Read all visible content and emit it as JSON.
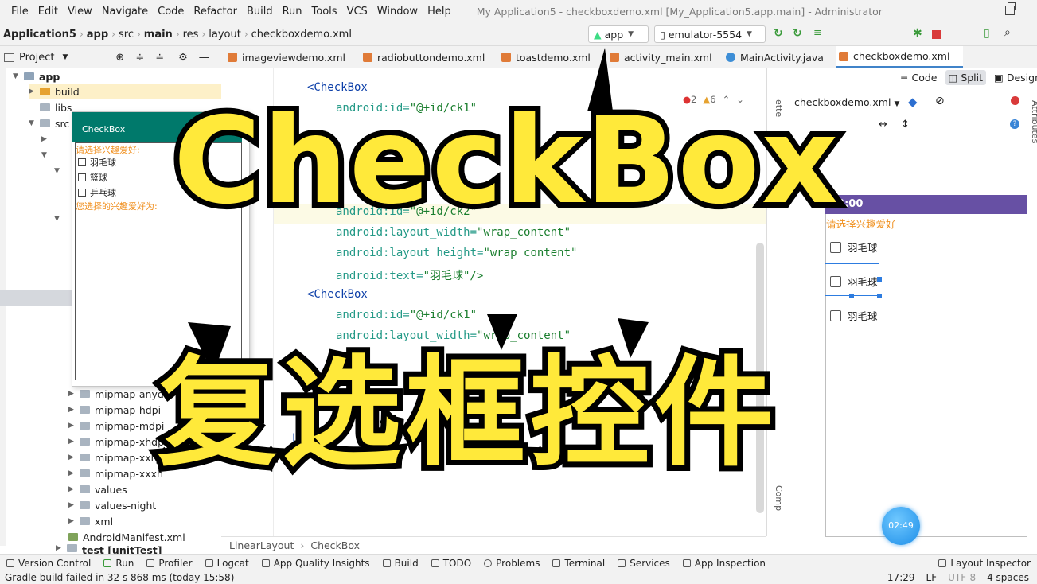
{
  "window": {
    "title": "My Application5 - checkboxdemo.xml [My_Application5.app.main] - Administrator"
  },
  "menu": [
    "File",
    "Edit",
    "View",
    "Navigate",
    "Code",
    "Refactor",
    "Build",
    "Run",
    "Tools",
    "VCS",
    "Window",
    "Help"
  ],
  "breadcrumb": [
    "Application5",
    "app",
    "src",
    "main",
    "res",
    "layout",
    "checkboxdemo.xml"
  ],
  "run_config": {
    "module": "app",
    "device": "emulator-5554"
  },
  "tabs": [
    "imageviewdemo.xml",
    "radiobuttondemo.xml",
    "toastdemo.xml",
    "activity_main.xml",
    "MainActivity.java",
    "checkboxdemo.xml"
  ],
  "project_panel": {
    "title": "Project",
    "tree": [
      "app",
      "build",
      "libs",
      "src",
      "mipmap-anyd",
      "mipmap-hdpi",
      "mipmap-mdpi",
      "mipmap-xhdp",
      "mipmap-xxhd",
      "mipmap-xxxh",
      "values",
      "values-night",
      "xml",
      "AndroidManifest.xml",
      "test [unitTest]"
    ]
  },
  "code_lines": [
    {
      "tag": "<CheckBox",
      "indent": 0
    },
    {
      "attr": "android:id=",
      "val": "\"@+id/ck1\"",
      "indent": 1
    },
    {
      "attr": "android:id=",
      "val": "\"@+id/ck2\"",
      "indent": 1
    },
    {
      "attr": "android:layout_width=",
      "val": "\"wrap_content\"",
      "indent": 1
    },
    {
      "attr": "android:layout_height=",
      "val": "\"wrap_content\"",
      "indent": 1
    },
    {
      "attr": "android:text=",
      "val": "\"羽毛球\"/>",
      "indent": 1
    },
    {
      "tag": "<CheckBox",
      "indent": 0
    },
    {
      "attr": "android:id=",
      "val": "\"@+id/ck1\"",
      "indent": 1
    },
    {
      "attr": "android:layout_width=",
      "val": "\"wrap_content\"",
      "indent": 1
    }
  ],
  "code_fragments": {
    "lin": "Li"
  },
  "inspection": {
    "errors": "2",
    "warnings": "6"
  },
  "view_modes": [
    "Code",
    "Split",
    "Design"
  ],
  "design": {
    "file": "checkboxdemo.xml",
    "time": "13:00",
    "label": "请选择兴趣爱好",
    "checkboxes": [
      "羽毛球",
      "羽毛球",
      "羽毛球"
    ]
  },
  "phone_preview": {
    "title": "CheckBox",
    "label": "请选择兴趣爱好:",
    "checkboxes": [
      "羽毛球",
      "篮球",
      "乒乓球"
    ],
    "result": "您选择的兴趣爱好为:"
  },
  "side_labels": {
    "palette": "ette",
    "attributes": "Attributes",
    "component": "Comp"
  },
  "bottom_breadcrumb": [
    "LinearLayout",
    "CheckBox"
  ],
  "bottom_tools": [
    "Version Control",
    "Run",
    "Profiler",
    "Logcat",
    "App Quality Insights",
    "Build",
    "TODO",
    "Problems",
    "Terminal",
    "Services",
    "App Inspection",
    "Layout Inspector"
  ],
  "status": {
    "message": "Gradle build failed in 32 s 868 ms (today 15:58)",
    "position": "17:29",
    "line_sep": "LF",
    "encoding": "UTF-8",
    "indent": "4 spaces"
  },
  "timer": "02:49",
  "overlay": {
    "title_en": "CheckBox",
    "title_zh": "复选框控件"
  },
  "colors": {
    "accent": "#4083c9",
    "preview_bar": "#6750a4",
    "phone_bar": "#00796b",
    "overlay_text": "#ffe93a"
  }
}
